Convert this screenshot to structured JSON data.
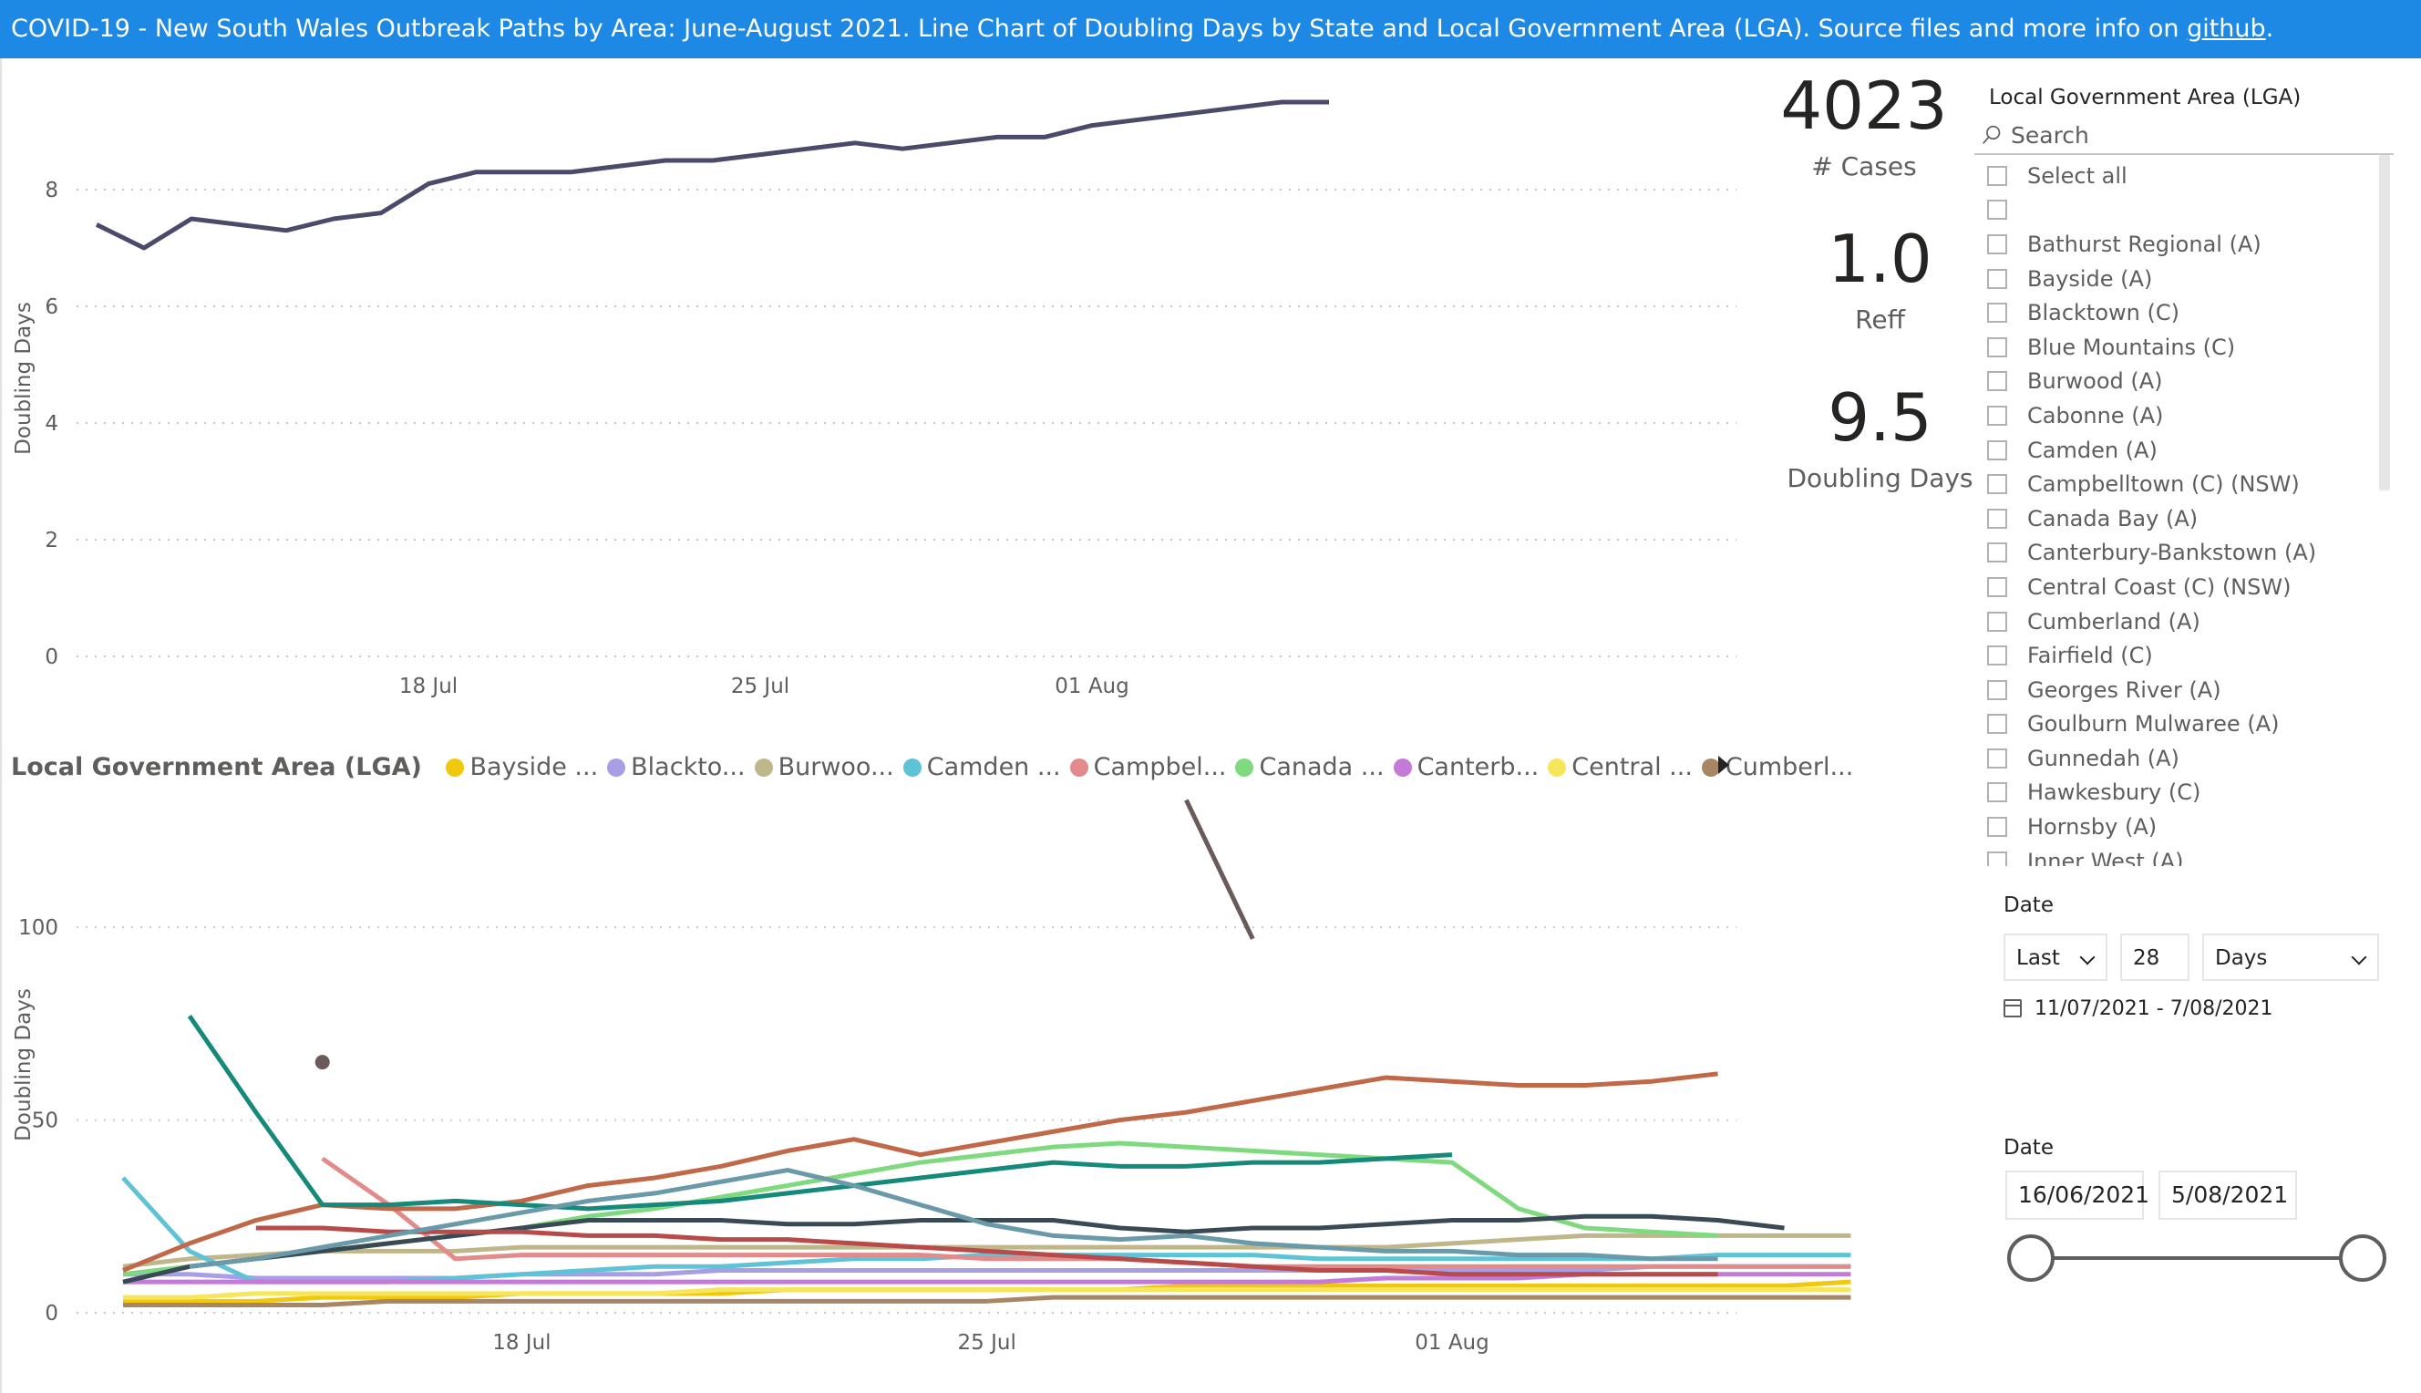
{
  "header": {
    "title": "COVID-19  - New South Wales Outbreak Paths by Area: June-August  2021.  Line Chart of Doubling Days by State and Local Government Area (LGA). Source files and more info on ",
    "link_label": "github",
    "title_end": "."
  },
  "cards": {
    "cases_value": "4023",
    "cases_label": "# Cases",
    "reff_value": "1.0",
    "reff_label": "Reff",
    "doubling_value": "9.5",
    "doubling_label": "Doubling Days"
  },
  "top_chart_labels": {
    "ylabel": "Doubling Days",
    "yticks": [
      "0",
      "2",
      "4",
      "6",
      "8"
    ],
    "xticks": [
      "18 Jul",
      "25 Jul",
      "01 Aug"
    ]
  },
  "bottom_chart_labels": {
    "ylabel": "Doubling Days",
    "yticks": [
      "0",
      "50",
      "100"
    ],
    "xticks": [
      "18 Jul",
      "25 Jul",
      "01 Aug"
    ]
  },
  "legend": {
    "title": "Local Government Area (LGA)",
    "items": [
      {
        "label": "Bayside ...",
        "color": "#f2c80f"
      },
      {
        "label": "Blackto...",
        "color": "#a79ee6"
      },
      {
        "label": "Burwoo...",
        "color": "#bfb68a"
      },
      {
        "label": "Camden ...",
        "color": "#5fc3d8"
      },
      {
        "label": "Campbel...",
        "color": "#e38a8a"
      },
      {
        "label": "Canada ...",
        "color": "#7fd97f"
      },
      {
        "label": "Canterb...",
        "color": "#c47ad7"
      },
      {
        "label": "Central ...",
        "color": "#f7e65a"
      },
      {
        "label": "Cumberl...",
        "color": "#a88664"
      }
    ]
  },
  "slicer": {
    "title": "Local Government Area (LGA)",
    "search_placeholder": "Search",
    "items": [
      "Select all",
      "",
      "Bathurst Regional (A)",
      "Bayside (A)",
      "Blacktown (C)",
      "Blue Mountains (C)",
      "Burwood (A)",
      "Cabonne (A)",
      "Camden (A)",
      "Campbelltown (C) (NSW)",
      "Canada Bay (A)",
      "Canterbury-Bankstown (A)",
      "Central Coast (C) (NSW)",
      "Cumberland (A)",
      "Fairfield (C)",
      "Georges River (A)",
      "Goulburn Mulwaree (A)",
      "Gunnedah (A)",
      "Hawkesbury (C)",
      "Hornsby (A)",
      "Inner West (A)"
    ]
  },
  "date_filter": {
    "title": "Date",
    "mode": "Last",
    "count": "28",
    "unit": "Days",
    "range_text": "11/07/2021 - 7/08/2021"
  },
  "date_slider": {
    "title": "Date",
    "start": "16/06/2021",
    "end": "5/08/2021"
  },
  "chart_data": [
    {
      "type": "line",
      "title": "",
      "ylabel": "Doubling Days",
      "xlabel": "",
      "ylim": [
        0,
        10
      ],
      "x": [
        "2021-07-11",
        "2021-07-12",
        "2021-07-13",
        "2021-07-14",
        "2021-07-15",
        "2021-07-16",
        "2021-07-17",
        "2021-07-18",
        "2021-07-19",
        "2021-07-20",
        "2021-07-21",
        "2021-07-22",
        "2021-07-23",
        "2021-07-24",
        "2021-07-25",
        "2021-07-26",
        "2021-07-27",
        "2021-07-28",
        "2021-07-29",
        "2021-07-30",
        "2021-07-31",
        "2021-08-01",
        "2021-08-02",
        "2021-08-03",
        "2021-08-04",
        "2021-08-05",
        "2021-08-06"
      ],
      "series": [
        {
          "color": "#4a4a6a",
          "values": [
            7.4,
            7.0,
            7.5,
            7.4,
            7.3,
            7.5,
            7.6,
            8.1,
            8.3,
            8.3,
            8.3,
            8.4,
            8.5,
            8.5,
            8.6,
            8.7,
            8.8,
            8.7,
            8.8,
            8.9,
            8.9,
            9.1,
            9.2,
            9.3,
            9.4,
            9.5,
            9.5
          ]
        }
      ],
      "grid": true
    },
    {
      "type": "line",
      "title": "",
      "ylabel": "Doubling Days",
      "xlabel": "",
      "ylim": [
        0,
        140
      ],
      "x_start": "2021-07-11",
      "series": [
        {
          "name": "Bayside (A)",
          "color": "#f2c80f",
          "values": [
            3,
            3,
            3,
            4,
            4,
            4,
            5,
            5,
            5,
            5,
            6,
            6,
            6,
            6,
            6,
            6,
            7,
            7,
            7,
            7,
            7,
            7,
            7,
            7,
            7,
            7,
            8
          ]
        },
        {
          "name": "Blacktown (C)",
          "color": "#a79ee6",
          "values": [
            10,
            10,
            9,
            9,
            9,
            9,
            10,
            10,
            10,
            11,
            11,
            11,
            11,
            11,
            11,
            11,
            11,
            11,
            11,
            11,
            11,
            11,
            11,
            12,
            12,
            12,
            12
          ]
        },
        {
          "name": "Burwood (A)",
          "color": "#bfb68a",
          "values": [
            12,
            14,
            15,
            16,
            16,
            16,
            17,
            17,
            17,
            17,
            17,
            17,
            17,
            17,
            17,
            17,
            17,
            17,
            17,
            17,
            18,
            19,
            20,
            20,
            20,
            20,
            20
          ]
        },
        {
          "name": "Camden (A)",
          "color": "#5fc3d8",
          "values": [
            35,
            16,
            8,
            8,
            8,
            9,
            10,
            11,
            12,
            12,
            13,
            14,
            14,
            15,
            15,
            15,
            15,
            15,
            14,
            14,
            14,
            14,
            14,
            14,
            15,
            15,
            15
          ]
        },
        {
          "name": "Campbelltown (C) (NSW)",
          "color": "#e38a8a",
          "values": [
            null,
            null,
            null,
            40,
            28,
            14,
            15,
            15,
            15,
            15,
            15,
            15,
            15,
            14,
            14,
            14,
            13,
            12,
            12,
            12,
            12,
            12,
            12,
            12,
            12,
            12,
            12
          ]
        },
        {
          "name": "Canada Bay (A)",
          "color": "#7fd97f",
          "values": [
            10,
            12,
            14,
            16,
            18,
            20,
            22,
            25,
            27,
            30,
            33,
            36,
            39,
            41,
            43,
            44,
            43,
            42,
            41,
            40,
            39,
            27,
            22,
            21,
            20,
            null,
            null
          ]
        },
        {
          "name": "Canterbury-Bankstown (A)",
          "color": "#c47ad7",
          "values": [
            8,
            8,
            8,
            8,
            8,
            8,
            8,
            8,
            8,
            8,
            8,
            8,
            8,
            8,
            8,
            8,
            8,
            8,
            8,
            9,
            9,
            9,
            10,
            10,
            10,
            10,
            10
          ]
        },
        {
          "name": "Central Coast (C) (NSW)",
          "color": "#f7e65a",
          "values": [
            4,
            4,
            5,
            5,
            5,
            5,
            5,
            5,
            5,
            6,
            6,
            6,
            6,
            6,
            6,
            6,
            6,
            6,
            6,
            6,
            6,
            6,
            6,
            6,
            6,
            6,
            6
          ]
        },
        {
          "name": "Cumberland (A)",
          "color": "#a88664",
          "values": [
            2,
            2,
            2,
            2,
            3,
            3,
            3,
            3,
            3,
            3,
            3,
            3,
            3,
            3,
            4,
            4,
            4,
            4,
            4,
            4,
            4,
            4,
            4,
            4,
            4,
            4,
            4
          ]
        },
        {
          "color": "#6b5a5a",
          "values": [
            null,
            null,
            null,
            65,
            null,
            null,
            null,
            null,
            null,
            null,
            null,
            null,
            null,
            null,
            null,
            null,
            133,
            97,
            null,
            null,
            null,
            null,
            null,
            null,
            null,
            null,
            null
          ]
        },
        {
          "color": "#c06848",
          "values": [
            11,
            18,
            24,
            28,
            27,
            27,
            29,
            33,
            35,
            38,
            42,
            45,
            41,
            44,
            47,
            50,
            52,
            55,
            58,
            61,
            60,
            59,
            59,
            60,
            62,
            null,
            null
          ]
        },
        {
          "color": "#168a7a",
          "values": [
            null,
            77,
            52,
            28,
            28,
            29,
            28,
            27,
            28,
            29,
            31,
            33,
            35,
            37,
            39,
            38,
            38,
            39,
            39,
            40,
            41,
            null,
            null,
            null,
            null,
            null,
            null
          ]
        },
        {
          "color": "#3a4a55",
          "values": [
            8,
            12,
            14,
            16,
            18,
            20,
            22,
            24,
            24,
            24,
            23,
            23,
            24,
            24,
            24,
            22,
            21,
            22,
            22,
            23,
            24,
            24,
            25,
            25,
            24,
            22,
            null
          ]
        },
        {
          "color": "#b84a4a",
          "values": [
            null,
            null,
            22,
            22,
            21,
            21,
            21,
            20,
            20,
            19,
            19,
            18,
            17,
            16,
            15,
            14,
            13,
            12,
            11,
            11,
            10,
            10,
            10,
            10,
            10,
            null,
            null
          ]
        },
        {
          "color": "#6a9aaa",
          "values": [
            null,
            12,
            14,
            17,
            20,
            23,
            26,
            29,
            31,
            34,
            37,
            33,
            28,
            23,
            20,
            19,
            20,
            18,
            17,
            16,
            16,
            15,
            15,
            14,
            14,
            null,
            null
          ]
        }
      ],
      "grid": true
    }
  ]
}
